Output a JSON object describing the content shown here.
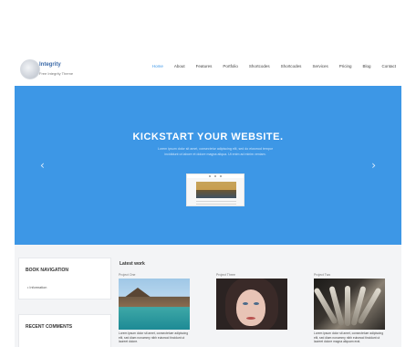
{
  "header": {
    "logo_title": "Integrity",
    "logo_subtitle": "Free Integrity Theme",
    "nav": [
      "Home",
      "About",
      "Features",
      "Portfolio",
      "Shortcodes",
      "Shortcodes",
      "Services",
      "Pricing",
      "Blog",
      "Contact"
    ],
    "active_nav": "Home"
  },
  "hero": {
    "title": "KICKSTART YOUR WEBSITE.",
    "text": "Lorem ipsum dolor sit amet, consectetur adipiscing elit, sed do eiusmod tempor incididunt ut labore et dolore magna aliqua. Ut enim ad minim veniam.",
    "prev_icon": "chevron-left-icon",
    "next_icon": "chevron-right-icon",
    "background_color": "#3d97e6"
  },
  "sidebar": {
    "widgets": [
      {
        "title": "BOOK NAVIGATION",
        "items": [
          "Information"
        ]
      },
      {
        "title": "RECENT COMMENTS",
        "items": []
      }
    ]
  },
  "latest": {
    "title": "Latest work",
    "cards": [
      {
        "label": "Project One",
        "image": "overwater-villa",
        "text": "Lorem ipsum dolor sit amet, consectetuer adipiscing elit, sed diam nonummy nibh euismod tincidunt ut laoreet dolore."
      },
      {
        "label": "Project Three",
        "image": "portrait",
        "text": ""
      },
      {
        "label": "Project Two",
        "image": "feathers",
        "text": "Lorem ipsum dolor sit amet, consectetuer adipiscing elit, sed diam nonummy nibh euismod tincidunt ut laoreet dolore magna aliquam erat."
      }
    ]
  }
}
